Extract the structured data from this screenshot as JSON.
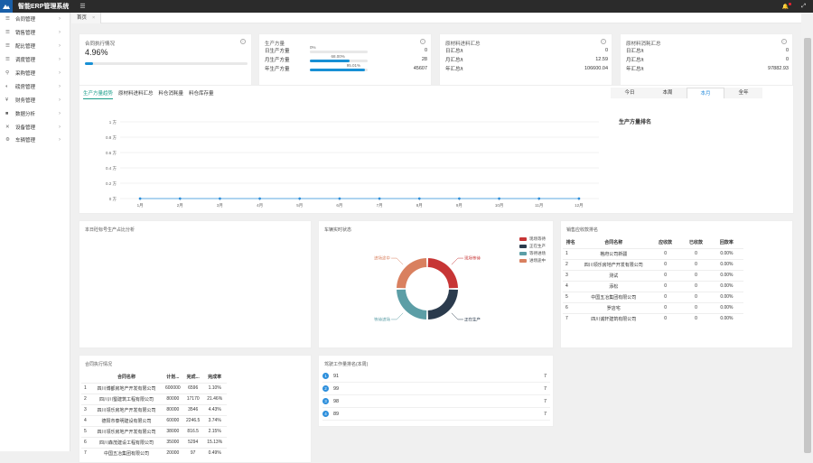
{
  "app": {
    "title": "智能ERP管理系统",
    "menu_icon": "hamburger-icon"
  },
  "topbar": {
    "bell_icon": "bell-icon",
    "fullscreen_icon": "fullscreen-icon"
  },
  "sidebar": {
    "items": [
      {
        "icon": "☰",
        "label": "合同管理"
      },
      {
        "icon": "☰",
        "label": "销售管理"
      },
      {
        "icon": "☰",
        "label": "配比管理"
      },
      {
        "icon": "☰",
        "label": "调度管理"
      },
      {
        "icon": "⚲",
        "label": "采购管理"
      },
      {
        "icon": "◐",
        "label": "磅房管理"
      },
      {
        "icon": "¥",
        "label": "财务管理"
      },
      {
        "icon": "■",
        "label": "数据分析"
      },
      {
        "icon": "✕",
        "label": "设备管理"
      },
      {
        "icon": "⚙",
        "label": "车辆管理"
      }
    ]
  },
  "tabs": {
    "home": "首页",
    "close": "×"
  },
  "contract_card": {
    "title": "合同执行情况",
    "value": "4.96%",
    "progress": 0.0496
  },
  "production_card": {
    "title": "生产方量",
    "rows": [
      {
        "label": "日生产方量",
        "value": "0",
        "pct_label": "0%",
        "progress": 0.0
      },
      {
        "label": "月生产方量",
        "value": "28",
        "pct_label": "68.00%",
        "progress": 0.68
      },
      {
        "label": "年生产方量",
        "value": "45607",
        "pct_label": "95.01%",
        "progress": 0.9501
      }
    ]
  },
  "material_in_card": {
    "title": "原材料进料汇总",
    "rows": [
      {
        "label": "日汇总/t",
        "value": "0"
      },
      {
        "label": "月汇总/t",
        "value": "12.59"
      },
      {
        "label": "年汇总/t",
        "value": "106600.04"
      }
    ]
  },
  "material_use_card": {
    "title": "原材料消耗汇总",
    "rows": [
      {
        "label": "日汇总/t",
        "value": "0"
      },
      {
        "label": "月汇总/t",
        "value": "0"
      },
      {
        "label": "年汇总/t",
        "value": "97882.93"
      }
    ]
  },
  "trend": {
    "tabs": [
      "生产方量趋势",
      "原材料进料汇总",
      "料仓消耗量",
      "料仓库存量"
    ],
    "period_tabs": [
      "今日",
      "本周",
      "本月",
      "全年"
    ],
    "active_period": 2,
    "ranking_title": "生产方量排名"
  },
  "chart_data": {
    "type": "line",
    "categories": [
      "1月",
      "2月",
      "3月",
      "4月",
      "5月",
      "6月",
      "7月",
      "8月",
      "9月",
      "10月",
      "11月",
      "12月"
    ],
    "values": [
      0,
      0,
      0,
      0,
      0,
      0,
      0,
      0,
      0,
      0,
      0,
      0
    ],
    "y_ticks": [
      "1 方",
      "0.8 方",
      "0.6 方",
      "0.4 方",
      "0.2 方",
      "0 方"
    ],
    "ylim": [
      0,
      1
    ],
    "color": "#2d8fdc"
  },
  "label_analysis": {
    "title": "本日砼标号生产占比分析"
  },
  "vehicle_status": {
    "title": "车辆实时状态",
    "legend": [
      {
        "name": "现场等待",
        "color": "#c73535"
      },
      {
        "name": "正在生产",
        "color": "#2b3b4d"
      },
      {
        "name": "等待进场",
        "color": "#5c9ea6"
      },
      {
        "name": "进场途中",
        "color": "#d9805f"
      }
    ],
    "slices": [
      0.25,
      0.25,
      0.25,
      0.25
    ]
  },
  "receivables": {
    "title": "销售应收款排名",
    "headers": [
      "排名",
      "合同名称",
      "应收款",
      "已收款",
      "回款率"
    ],
    "rows": [
      [
        "1",
        "格府公司新疆",
        "0",
        "0",
        "0.00%"
      ],
      [
        "2",
        "四川领乐房地产开发有限公司",
        "0",
        "0",
        "0.00%"
      ],
      [
        "3",
        "测试",
        "0",
        "0",
        "0.00%"
      ],
      [
        "4",
        "添松",
        "0",
        "0",
        "0.00%"
      ],
      [
        "5",
        "中国五冶集团有限公司",
        "0",
        "0",
        "0.00%"
      ],
      [
        "6",
        "罗店宅",
        "0",
        "0",
        "0.00%"
      ],
      [
        "7",
        "四川诚轩建筑有限公司",
        "0",
        "0",
        "0.00%"
      ]
    ]
  },
  "contract_exec": {
    "title": "合同执行情况",
    "headers": [
      "",
      "合同名称",
      "计划...",
      "完成...",
      "完成率"
    ],
    "rows": [
      [
        "1",
        "四川博都房地产开发有限公司",
        "600000",
        "6596",
        "1.10%"
      ],
      [
        "2",
        "四川川蜀建筑工程有限公司",
        "80000",
        "17170",
        "21.46%"
      ],
      [
        "3",
        "四川领乐房地产开发有限公司",
        "80000",
        "3546",
        "4.43%"
      ],
      [
        "4",
        "德阳市泰明建设有限公司",
        "60000",
        "2246.5",
        "3.74%"
      ],
      [
        "5",
        "四川领乐房地产开发有限公司",
        "38000",
        "816.5",
        "2.15%"
      ],
      [
        "6",
        "四川森茂建设工程有限公司",
        "35000",
        "5294",
        "15.13%"
      ],
      [
        "7",
        "中国五冶集团有限公司",
        "20000",
        "97",
        "0.49%"
      ]
    ]
  },
  "driver_rank": {
    "title": "驾驶工作量排名(本周)",
    "rows": [
      {
        "rank": "1",
        "name": "91",
        "value": "7"
      },
      {
        "rank": "2",
        "name": "99",
        "value": "7"
      },
      {
        "rank": "3",
        "name": "98",
        "value": "7"
      },
      {
        "rank": "4",
        "name": "89",
        "value": "7"
      }
    ]
  }
}
